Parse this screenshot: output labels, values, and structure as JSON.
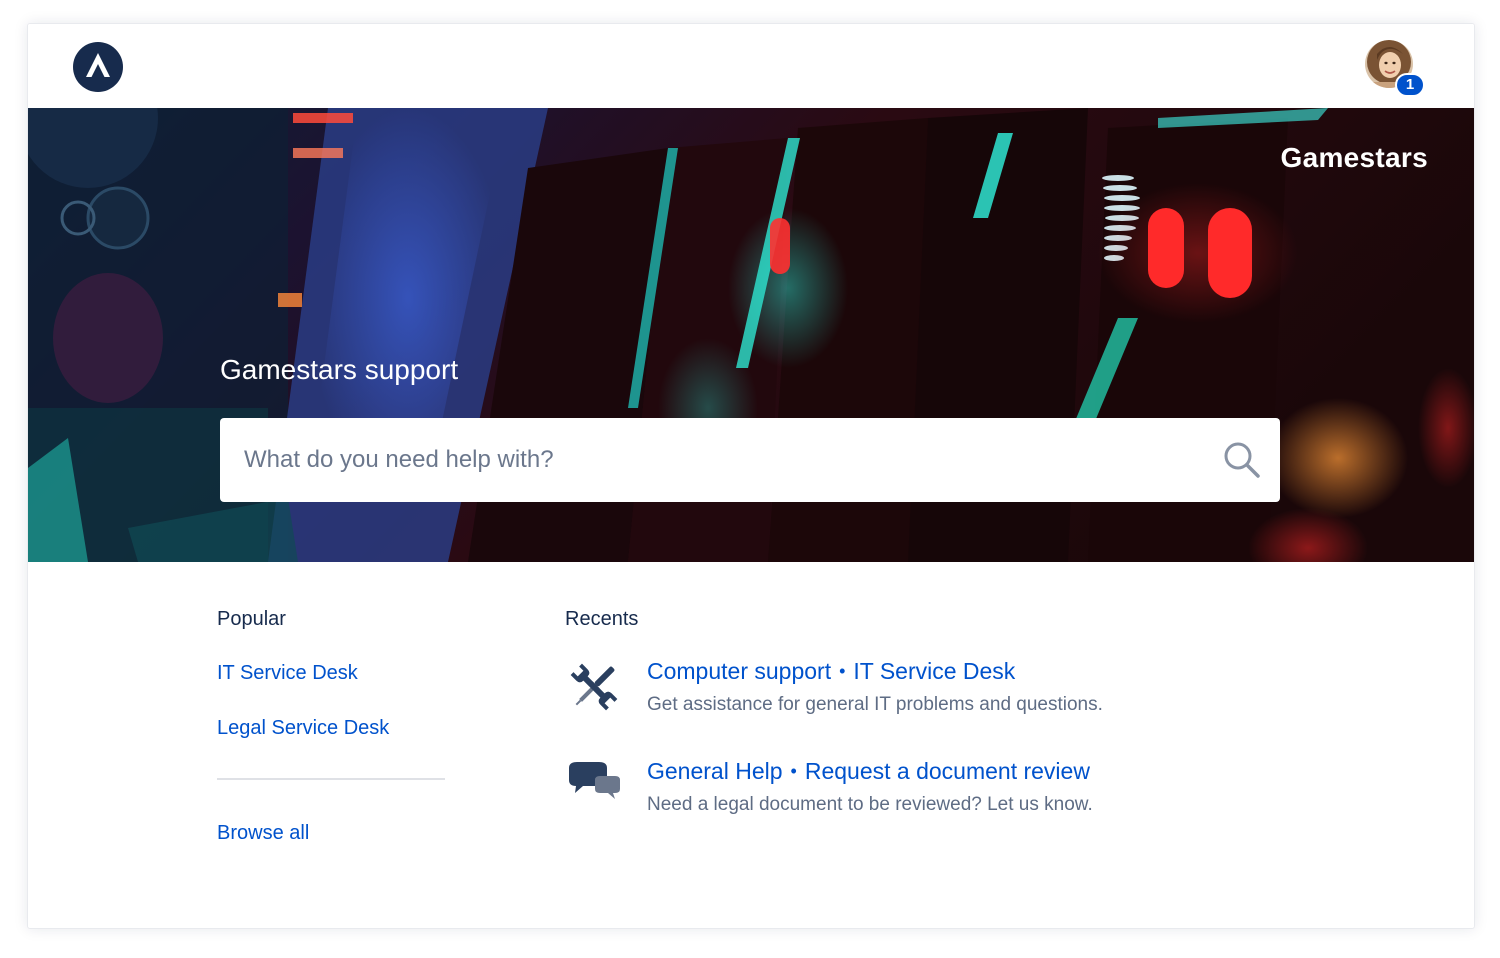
{
  "topbar": {
    "logo_icon": "atlassian-logo-icon",
    "notification_count": "1"
  },
  "hero": {
    "brand": "Gamestars",
    "title": "Gamestars support",
    "search_placeholder": "What do you need help with?",
    "search_icon": "search-icon"
  },
  "popular": {
    "title": "Popular",
    "items": [
      {
        "label": "IT Service Desk"
      },
      {
        "label": "Legal Service Desk"
      }
    ],
    "browse_all": "Browse all"
  },
  "recents": {
    "title": "Recents",
    "items": [
      {
        "icon": "wrench-screwdriver-icon",
        "request": "Computer support",
        "desk": "IT Service Desk",
        "description": "Get assistance for general IT problems and questions."
      },
      {
        "icon": "chat-bubbles-icon",
        "request": "General Help",
        "desk": "Request a document review",
        "description": "Need a legal document to be reviewed? Let us know."
      }
    ]
  },
  "colors": {
    "link": "#0052cc",
    "text": "#172b4d",
    "subtle_text": "#5e6c84",
    "logo_navy": "#172b4d",
    "icon_navy": "#2a3f5f"
  }
}
